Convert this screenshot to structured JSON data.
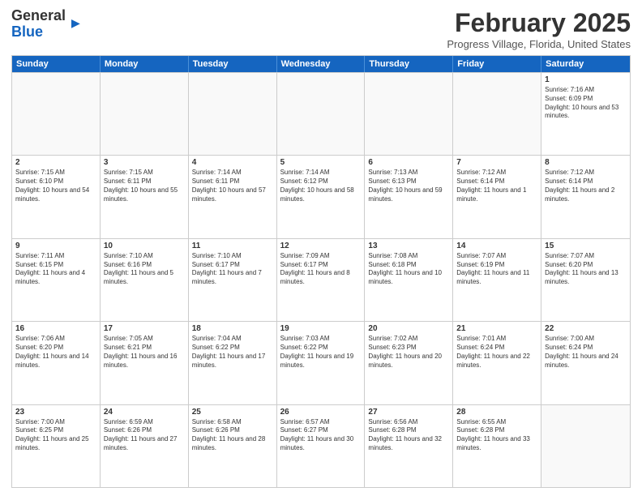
{
  "logo": {
    "line1": "General",
    "line2": "Blue"
  },
  "header": {
    "title": "February 2025",
    "subtitle": "Progress Village, Florida, United States"
  },
  "days_of_week": [
    "Sunday",
    "Monday",
    "Tuesday",
    "Wednesday",
    "Thursday",
    "Friday",
    "Saturday"
  ],
  "weeks": [
    [
      {
        "day": "",
        "info": ""
      },
      {
        "day": "",
        "info": ""
      },
      {
        "day": "",
        "info": ""
      },
      {
        "day": "",
        "info": ""
      },
      {
        "day": "",
        "info": ""
      },
      {
        "day": "",
        "info": ""
      },
      {
        "day": "1",
        "info": "Sunrise: 7:16 AM\nSunset: 6:09 PM\nDaylight: 10 hours and 53 minutes."
      }
    ],
    [
      {
        "day": "2",
        "info": "Sunrise: 7:15 AM\nSunset: 6:10 PM\nDaylight: 10 hours and 54 minutes."
      },
      {
        "day": "3",
        "info": "Sunrise: 7:15 AM\nSunset: 6:11 PM\nDaylight: 10 hours and 55 minutes."
      },
      {
        "day": "4",
        "info": "Sunrise: 7:14 AM\nSunset: 6:11 PM\nDaylight: 10 hours and 57 minutes."
      },
      {
        "day": "5",
        "info": "Sunrise: 7:14 AM\nSunset: 6:12 PM\nDaylight: 10 hours and 58 minutes."
      },
      {
        "day": "6",
        "info": "Sunrise: 7:13 AM\nSunset: 6:13 PM\nDaylight: 10 hours and 59 minutes."
      },
      {
        "day": "7",
        "info": "Sunrise: 7:12 AM\nSunset: 6:14 PM\nDaylight: 11 hours and 1 minute."
      },
      {
        "day": "8",
        "info": "Sunrise: 7:12 AM\nSunset: 6:14 PM\nDaylight: 11 hours and 2 minutes."
      }
    ],
    [
      {
        "day": "9",
        "info": "Sunrise: 7:11 AM\nSunset: 6:15 PM\nDaylight: 11 hours and 4 minutes."
      },
      {
        "day": "10",
        "info": "Sunrise: 7:10 AM\nSunset: 6:16 PM\nDaylight: 11 hours and 5 minutes."
      },
      {
        "day": "11",
        "info": "Sunrise: 7:10 AM\nSunset: 6:17 PM\nDaylight: 11 hours and 7 minutes."
      },
      {
        "day": "12",
        "info": "Sunrise: 7:09 AM\nSunset: 6:17 PM\nDaylight: 11 hours and 8 minutes."
      },
      {
        "day": "13",
        "info": "Sunrise: 7:08 AM\nSunset: 6:18 PM\nDaylight: 11 hours and 10 minutes."
      },
      {
        "day": "14",
        "info": "Sunrise: 7:07 AM\nSunset: 6:19 PM\nDaylight: 11 hours and 11 minutes."
      },
      {
        "day": "15",
        "info": "Sunrise: 7:07 AM\nSunset: 6:20 PM\nDaylight: 11 hours and 13 minutes."
      }
    ],
    [
      {
        "day": "16",
        "info": "Sunrise: 7:06 AM\nSunset: 6:20 PM\nDaylight: 11 hours and 14 minutes."
      },
      {
        "day": "17",
        "info": "Sunrise: 7:05 AM\nSunset: 6:21 PM\nDaylight: 11 hours and 16 minutes."
      },
      {
        "day": "18",
        "info": "Sunrise: 7:04 AM\nSunset: 6:22 PM\nDaylight: 11 hours and 17 minutes."
      },
      {
        "day": "19",
        "info": "Sunrise: 7:03 AM\nSunset: 6:22 PM\nDaylight: 11 hours and 19 minutes."
      },
      {
        "day": "20",
        "info": "Sunrise: 7:02 AM\nSunset: 6:23 PM\nDaylight: 11 hours and 20 minutes."
      },
      {
        "day": "21",
        "info": "Sunrise: 7:01 AM\nSunset: 6:24 PM\nDaylight: 11 hours and 22 minutes."
      },
      {
        "day": "22",
        "info": "Sunrise: 7:00 AM\nSunset: 6:24 PM\nDaylight: 11 hours and 24 minutes."
      }
    ],
    [
      {
        "day": "23",
        "info": "Sunrise: 7:00 AM\nSunset: 6:25 PM\nDaylight: 11 hours and 25 minutes."
      },
      {
        "day": "24",
        "info": "Sunrise: 6:59 AM\nSunset: 6:26 PM\nDaylight: 11 hours and 27 minutes."
      },
      {
        "day": "25",
        "info": "Sunrise: 6:58 AM\nSunset: 6:26 PM\nDaylight: 11 hours and 28 minutes."
      },
      {
        "day": "26",
        "info": "Sunrise: 6:57 AM\nSunset: 6:27 PM\nDaylight: 11 hours and 30 minutes."
      },
      {
        "day": "27",
        "info": "Sunrise: 6:56 AM\nSunset: 6:28 PM\nDaylight: 11 hours and 32 minutes."
      },
      {
        "day": "28",
        "info": "Sunrise: 6:55 AM\nSunset: 6:28 PM\nDaylight: 11 hours and 33 minutes."
      },
      {
        "day": "",
        "info": ""
      }
    ]
  ]
}
